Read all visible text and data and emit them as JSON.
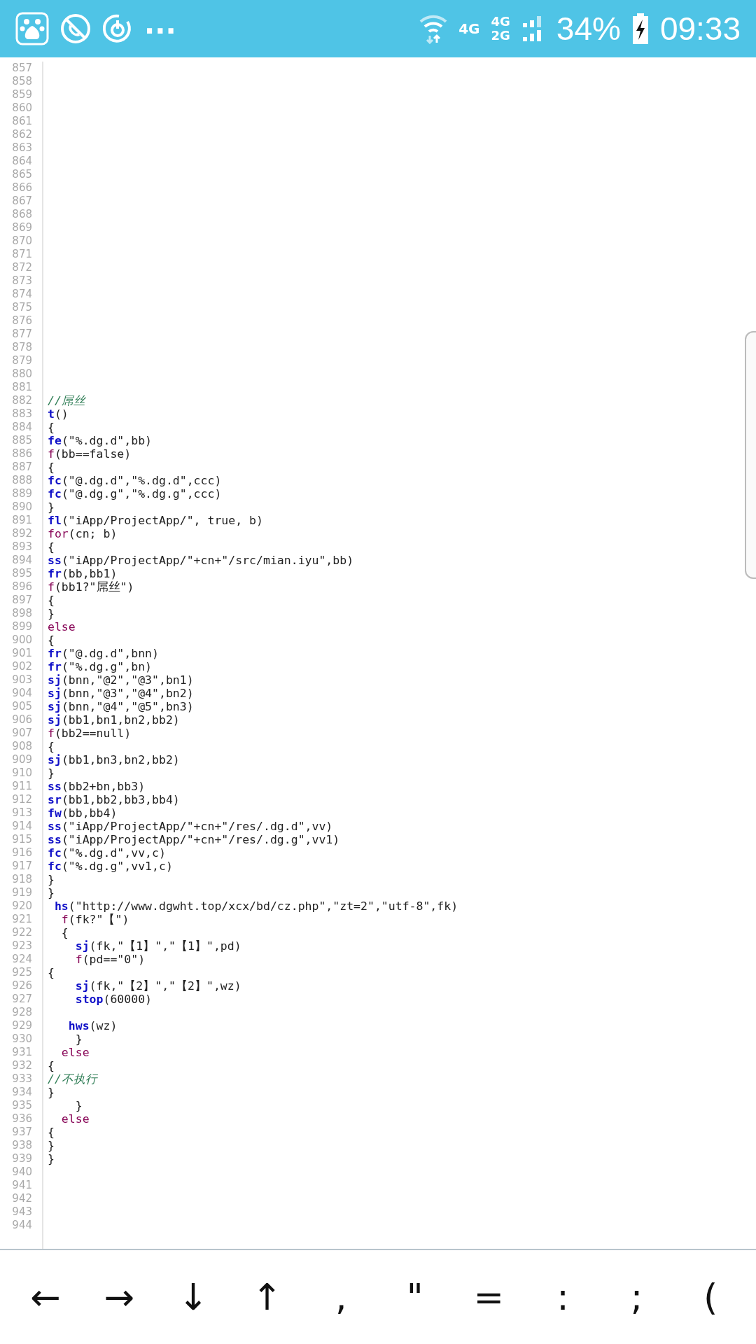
{
  "status_bar": {
    "more": "...",
    "network_a": "4G",
    "network_b_top": "4G",
    "network_b_bottom": "2G",
    "battery": "34%",
    "time": "09:33"
  },
  "editor": {
    "lines": [
      {
        "number": "857"
      },
      {
        "number": "858"
      },
      {
        "number": "859"
      },
      {
        "number": "860"
      },
      {
        "number": "861"
      },
      {
        "number": "862"
      },
      {
        "number": "863"
      },
      {
        "number": "864"
      },
      {
        "number": "865"
      },
      {
        "number": "866"
      },
      {
        "number": "867"
      },
      {
        "number": "868"
      },
      {
        "number": "869"
      },
      {
        "number": "870"
      },
      {
        "number": "871"
      },
      {
        "number": "872"
      },
      {
        "number": "873"
      },
      {
        "number": "874"
      },
      {
        "number": "875"
      },
      {
        "number": "876"
      },
      {
        "number": "877"
      },
      {
        "number": "878"
      },
      {
        "number": "879"
      },
      {
        "number": "880"
      },
      {
        "number": "881"
      },
      {
        "number": "882",
        "tokens": [
          {
            "kind": "comment",
            "text": "//屌丝"
          }
        ]
      },
      {
        "number": "883",
        "tokens": [
          {
            "kind": "func",
            "text": "t"
          },
          {
            "kind": "plain",
            "text": "()"
          }
        ]
      },
      {
        "number": "884",
        "tokens": [
          {
            "kind": "plain",
            "text": "{"
          }
        ]
      },
      {
        "number": "885",
        "tokens": [
          {
            "kind": "func",
            "text": "fe"
          },
          {
            "kind": "plain",
            "text": "(\"%.dg.d\",bb)"
          }
        ]
      },
      {
        "number": "886",
        "tokens": [
          {
            "kind": "control",
            "text": "f"
          },
          {
            "kind": "plain",
            "text": "(bb==false)"
          }
        ]
      },
      {
        "number": "887",
        "tokens": [
          {
            "kind": "plain",
            "text": "{"
          }
        ]
      },
      {
        "number": "888",
        "tokens": [
          {
            "kind": "func",
            "text": "fc"
          },
          {
            "kind": "plain",
            "text": "(\"@.dg.d\",\"%.dg.d\",ccc)"
          }
        ]
      },
      {
        "number": "889",
        "tokens": [
          {
            "kind": "func",
            "text": "fc"
          },
          {
            "kind": "plain",
            "text": "(\"@.dg.g\",\"%.dg.g\",ccc)"
          }
        ]
      },
      {
        "number": "890",
        "tokens": [
          {
            "kind": "plain",
            "text": "}"
          }
        ]
      },
      {
        "number": "891",
        "tokens": [
          {
            "kind": "func",
            "text": "fl"
          },
          {
            "kind": "plain",
            "text": "(\"iApp/ProjectApp/\", true, b)"
          }
        ]
      },
      {
        "number": "892",
        "tokens": [
          {
            "kind": "control",
            "text": "for"
          },
          {
            "kind": "plain",
            "text": "(cn; b)"
          }
        ]
      },
      {
        "number": "893",
        "tokens": [
          {
            "kind": "plain",
            "text": "{"
          }
        ]
      },
      {
        "number": "894",
        "tokens": [
          {
            "kind": "func",
            "text": "ss"
          },
          {
            "kind": "plain",
            "text": "(\"iApp/ProjectApp/\"+cn+\"/src/mian.iyu\",bb)"
          }
        ]
      },
      {
        "number": "895",
        "tokens": [
          {
            "kind": "func",
            "text": "fr"
          },
          {
            "kind": "plain",
            "text": "(bb,bb1)"
          }
        ]
      },
      {
        "number": "896",
        "tokens": [
          {
            "kind": "control",
            "text": "f"
          },
          {
            "kind": "plain",
            "text": "(bb1?\"屌丝\")"
          }
        ]
      },
      {
        "number": "897",
        "tokens": [
          {
            "kind": "plain",
            "text": "{"
          }
        ]
      },
      {
        "number": "898",
        "tokens": [
          {
            "kind": "plain",
            "text": "}"
          }
        ]
      },
      {
        "number": "899",
        "tokens": [
          {
            "kind": "control",
            "text": "else"
          }
        ]
      },
      {
        "number": "900",
        "tokens": [
          {
            "kind": "plain",
            "text": "{"
          }
        ]
      },
      {
        "number": "901",
        "tokens": [
          {
            "kind": "func",
            "text": "fr"
          },
          {
            "kind": "plain",
            "text": "(\"@.dg.d\",bnn)"
          }
        ]
      },
      {
        "number": "902",
        "tokens": [
          {
            "kind": "func",
            "text": "fr"
          },
          {
            "kind": "plain",
            "text": "(\"%.dg.g\",bn)"
          }
        ]
      },
      {
        "number": "903",
        "tokens": [
          {
            "kind": "func",
            "text": "sj"
          },
          {
            "kind": "plain",
            "text": "(bnn,\"@2\",\"@3\",bn1)"
          }
        ]
      },
      {
        "number": "904",
        "tokens": [
          {
            "kind": "func",
            "text": "sj"
          },
          {
            "kind": "plain",
            "text": "(bnn,\"@3\",\"@4\",bn2)"
          }
        ]
      },
      {
        "number": "905",
        "tokens": [
          {
            "kind": "func",
            "text": "sj"
          },
          {
            "kind": "plain",
            "text": "(bnn,\"@4\",\"@5\",bn3)"
          }
        ]
      },
      {
        "number": "906",
        "tokens": [
          {
            "kind": "func",
            "text": "sj"
          },
          {
            "kind": "plain",
            "text": "(bb1,bn1,bn2,bb2)"
          }
        ]
      },
      {
        "number": "907",
        "tokens": [
          {
            "kind": "control",
            "text": "f"
          },
          {
            "kind": "plain",
            "text": "(bb2==null)"
          }
        ]
      },
      {
        "number": "908",
        "tokens": [
          {
            "kind": "plain",
            "text": "{"
          }
        ]
      },
      {
        "number": "909",
        "tokens": [
          {
            "kind": "func",
            "text": "sj"
          },
          {
            "kind": "plain",
            "text": "(bb1,bn3,bn2,bb2)"
          }
        ]
      },
      {
        "number": "910",
        "tokens": [
          {
            "kind": "plain",
            "text": "}"
          }
        ]
      },
      {
        "number": "911",
        "tokens": [
          {
            "kind": "func",
            "text": "ss"
          },
          {
            "kind": "plain",
            "text": "(bb2+bn,bb3)"
          }
        ]
      },
      {
        "number": "912",
        "tokens": [
          {
            "kind": "func",
            "text": "sr"
          },
          {
            "kind": "plain",
            "text": "(bb1,bb2,bb3,bb4)"
          }
        ]
      },
      {
        "number": "913",
        "tokens": [
          {
            "kind": "func",
            "text": "fw"
          },
          {
            "kind": "plain",
            "text": "(bb,bb4)"
          }
        ]
      },
      {
        "number": "914",
        "tokens": [
          {
            "kind": "func",
            "text": "ss"
          },
          {
            "kind": "plain",
            "text": "(\"iApp/ProjectApp/\"+cn+\"/res/.dg.d\",vv)"
          }
        ]
      },
      {
        "number": "915",
        "tokens": [
          {
            "kind": "func",
            "text": "ss"
          },
          {
            "kind": "plain",
            "text": "(\"iApp/ProjectApp/\"+cn+\"/res/.dg.g\",vv1)"
          }
        ]
      },
      {
        "number": "916",
        "tokens": [
          {
            "kind": "func",
            "text": "fc"
          },
          {
            "kind": "plain",
            "text": "(\"%.dg.d\",vv,c)"
          }
        ]
      },
      {
        "number": "917",
        "tokens": [
          {
            "kind": "func",
            "text": "fc"
          },
          {
            "kind": "plain",
            "text": "(\"%.dg.g\",vv1,c)"
          }
        ]
      },
      {
        "number": "918",
        "tokens": [
          {
            "kind": "plain",
            "text": "}"
          }
        ]
      },
      {
        "number": "919",
        "tokens": [
          {
            "kind": "plain",
            "text": "}"
          }
        ]
      },
      {
        "number": "920",
        "tokens": [
          {
            "kind": "func",
            "text": " hs"
          },
          {
            "kind": "plain",
            "text": "(\"http://www.dgwht.top/xcx/bd/cz.php\",\"zt=2\",\"utf-8\",fk)"
          }
        ]
      },
      {
        "number": "921",
        "tokens": [
          {
            "kind": "control",
            "text": "  f"
          },
          {
            "kind": "plain",
            "text": "(fk?\"【\")"
          }
        ]
      },
      {
        "number": "922",
        "tokens": [
          {
            "kind": "plain",
            "text": "  {"
          }
        ]
      },
      {
        "number": "923",
        "tokens": [
          {
            "kind": "func",
            "text": "    sj"
          },
          {
            "kind": "plain",
            "text": "(fk,\"【1】\",\"【1】\",pd)"
          }
        ]
      },
      {
        "number": "924",
        "tokens": [
          {
            "kind": "control",
            "text": "    f"
          },
          {
            "kind": "plain",
            "text": "(pd==\"0\")"
          }
        ]
      },
      {
        "number": "925",
        "tokens": [
          {
            "kind": "plain",
            "text": "{"
          }
        ]
      },
      {
        "number": "926",
        "tokens": [
          {
            "kind": "func",
            "text": "    sj"
          },
          {
            "kind": "plain",
            "text": "(fk,\"【2】\",\"【2】\",wz)"
          }
        ]
      },
      {
        "number": "927",
        "tokens": [
          {
            "kind": "func",
            "text": "    stop"
          },
          {
            "kind": "plain",
            "text": "(60000)"
          }
        ]
      },
      {
        "number": "928"
      },
      {
        "number": "929",
        "tokens": [
          {
            "kind": "func",
            "text": "   hws"
          },
          {
            "kind": "plain",
            "text": "(wz)"
          }
        ]
      },
      {
        "number": "930",
        "tokens": [
          {
            "kind": "plain",
            "text": "    }"
          }
        ]
      },
      {
        "number": "931",
        "tokens": [
          {
            "kind": "control",
            "text": "  else"
          }
        ]
      },
      {
        "number": "932",
        "tokens": [
          {
            "kind": "plain",
            "text": "{"
          }
        ]
      },
      {
        "number": "933",
        "tokens": [
          {
            "kind": "comment",
            "text": "//不执行"
          }
        ]
      },
      {
        "number": "934",
        "tokens": [
          {
            "kind": "plain",
            "text": "}"
          }
        ]
      },
      {
        "number": "935",
        "tokens": [
          {
            "kind": "plain",
            "text": "    }"
          }
        ]
      },
      {
        "number": "936",
        "tokens": [
          {
            "kind": "control",
            "text": "  else"
          }
        ]
      },
      {
        "number": "937",
        "tokens": [
          {
            "kind": "plain",
            "text": "{"
          }
        ]
      },
      {
        "number": "938",
        "tokens": [
          {
            "kind": "plain",
            "text": "}"
          }
        ]
      },
      {
        "number": "939",
        "tokens": [
          {
            "kind": "plain",
            "text": "}"
          }
        ]
      },
      {
        "number": "940"
      },
      {
        "number": "941"
      },
      {
        "number": "942"
      },
      {
        "number": "943"
      },
      {
        "number": "944"
      }
    ]
  },
  "keys": [
    "←",
    "→",
    "↓",
    "↑",
    ",",
    "\"",
    "=",
    ":",
    ";",
    "("
  ]
}
